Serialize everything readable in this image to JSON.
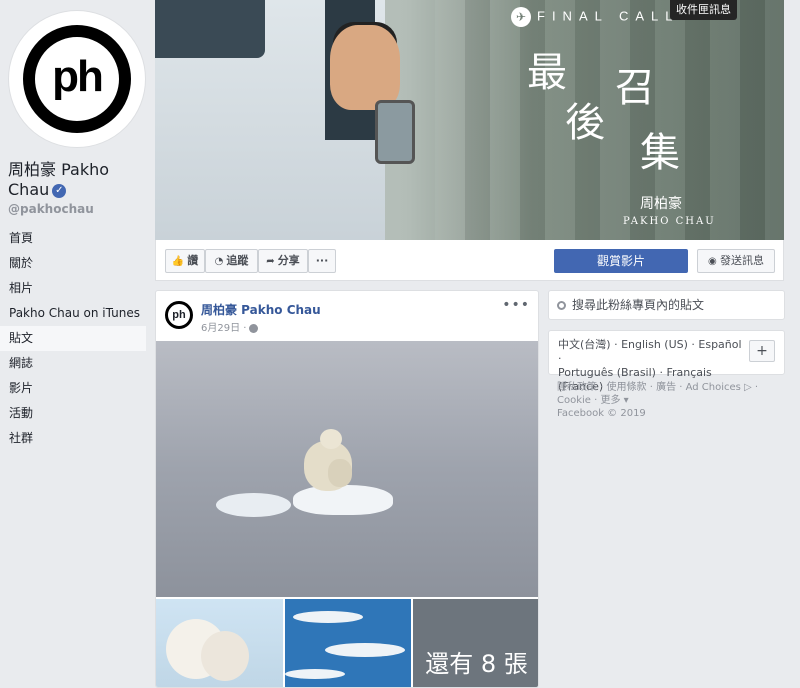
{
  "profile": {
    "avatar_text": "ph",
    "name": "周柏豪 Pakho Chau",
    "verified_mark": "✓",
    "handle": "@pakhochau"
  },
  "nav": {
    "items": [
      "首頁",
      "關於",
      "相片",
      "Pakho Chau on iTunes",
      "貼文",
      "網誌",
      "影片",
      "活動",
      "社群"
    ],
    "active_index": 4
  },
  "cover": {
    "brand": "FINAL CALL",
    "plane_glyph": "✈",
    "title_chars": [
      "最",
      "後",
      "召",
      "集"
    ],
    "artist_cn": "周柏豪",
    "artist_en": "PAKHO CHAU",
    "inbox_tooltip": "收件匣訊息"
  },
  "actions": {
    "like": "讚",
    "follow": "追蹤",
    "share": "分享",
    "more": "···",
    "watch_video": "觀賞影片",
    "send_message": "發送訊息"
  },
  "post": {
    "avatar_text": "ph",
    "author": "周柏豪 Pakho Chau",
    "date": "6月29日 ·",
    "more": "•••",
    "more_photos": "還有 8 張"
  },
  "sidebar": {
    "search_placeholder": "搜尋此粉絲專頁內的貼文",
    "languages_line1": "中文(台灣) · English (US) · Español ·",
    "languages_line2": "Português (Brasil) · Français (France)",
    "add_language": "+",
    "footer_line1": "隱私政策 · 使用條款 · 廣告 · Ad Choices ▷ ·",
    "footer_line2": "Cookie · 更多 ▾",
    "footer_line3": "Facebook © 2019"
  },
  "colors": {
    "brand_blue": "#4267b2",
    "link_blue": "#365899",
    "background": "#e9ebee"
  }
}
